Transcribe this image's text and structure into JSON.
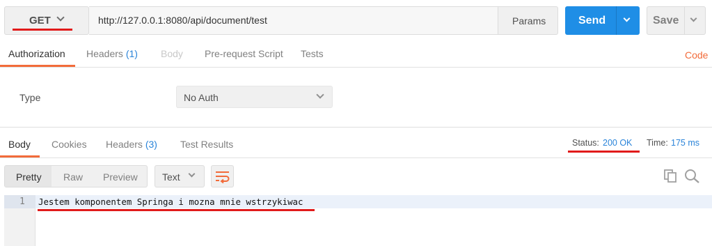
{
  "request": {
    "method": "GET",
    "url": "http://127.0.0.1:8080/api/document/test",
    "params_label": "Params",
    "send_label": "Send",
    "save_label": "Save"
  },
  "request_tabs": [
    {
      "label": "Authorization",
      "count": ""
    },
    {
      "label": "Headers",
      "count": "(1)"
    },
    {
      "label": "Body",
      "count": ""
    },
    {
      "label": "Pre-request Script",
      "count": ""
    },
    {
      "label": "Tests",
      "count": ""
    }
  ],
  "code_link": "Code",
  "auth": {
    "type_label": "Type",
    "selected": "No Auth"
  },
  "response_tabs": [
    {
      "label": "Body",
      "count": ""
    },
    {
      "label": "Cookies",
      "count": ""
    },
    {
      "label": "Headers",
      "count": "(3)"
    },
    {
      "label": "Test Results",
      "count": ""
    }
  ],
  "status": {
    "label": "Status:",
    "value": "200 OK",
    "time_label": "Time:",
    "time_value": "175 ms"
  },
  "view_modes": [
    "Pretty",
    "Raw",
    "Preview"
  ],
  "format": "Text",
  "response_body": {
    "lines": [
      {
        "number": "1",
        "text": "Jestem komponentem Springa i mozna mnie wstrzykiwac"
      }
    ]
  },
  "colors": {
    "accent": "#f26b3a",
    "send": "#1f8ee6",
    "link": "#2a84d9",
    "annotation": "#e11a1a"
  }
}
